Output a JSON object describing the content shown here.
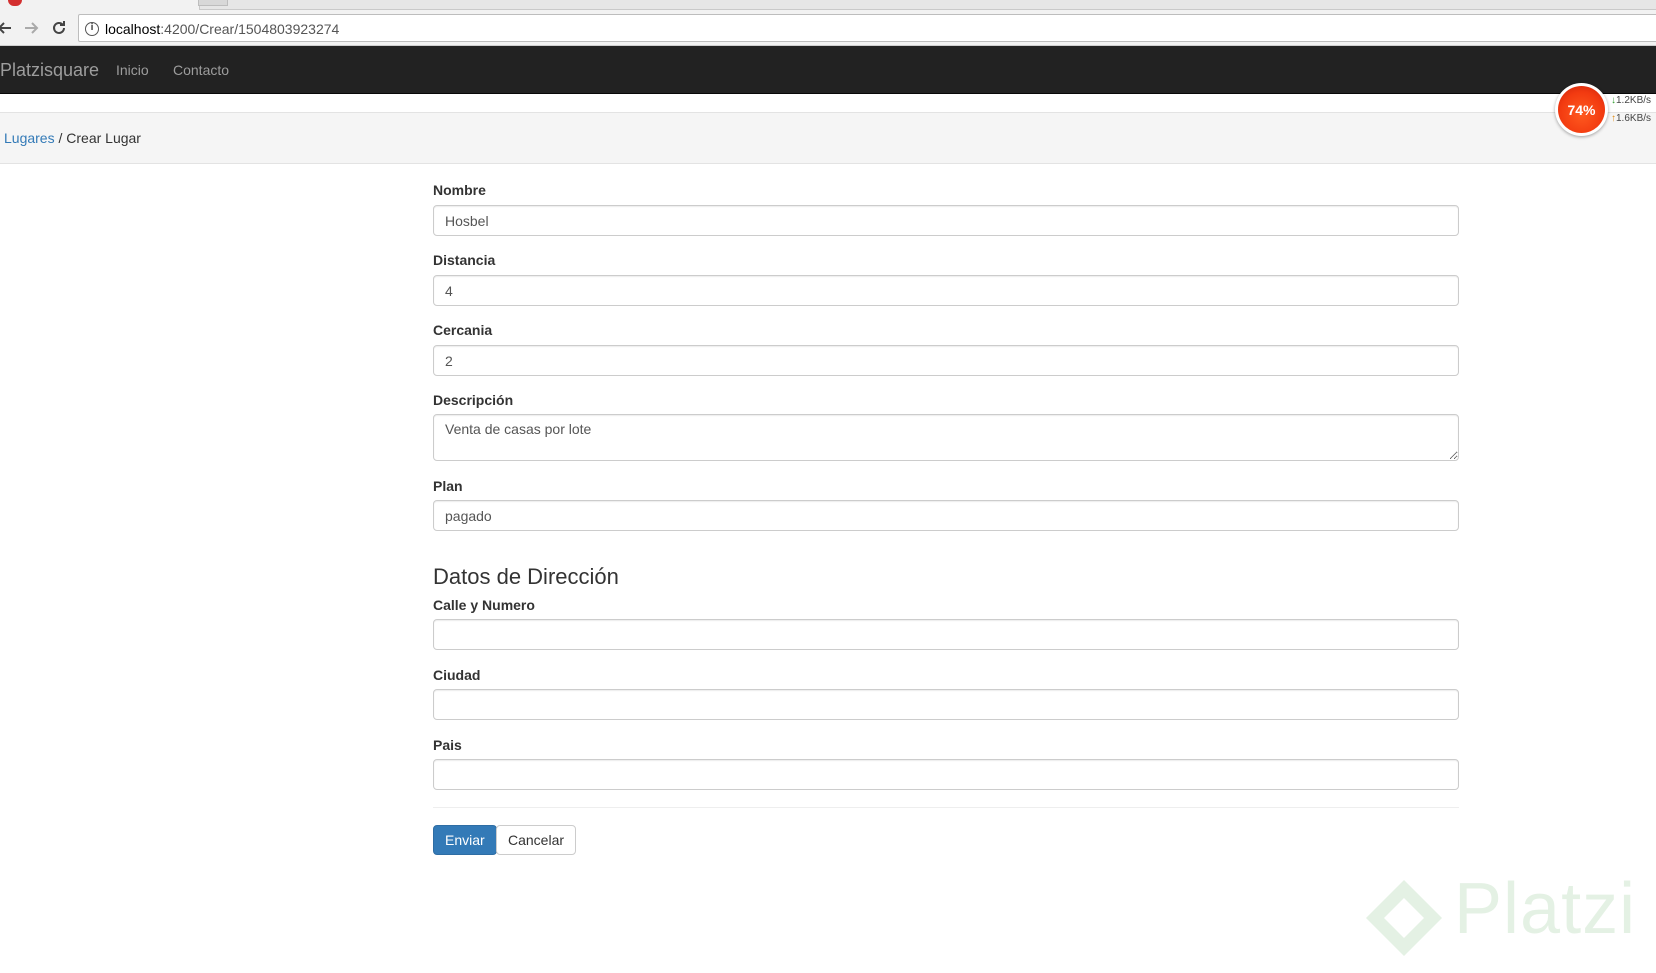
{
  "browser": {
    "url_host": "localhost",
    "url_path": ":4200/Crear/1504803923274"
  },
  "navbar": {
    "brand": "Platzisquare",
    "links": [
      "Inicio",
      "Contacto"
    ]
  },
  "breadcrumb": {
    "parent": "Lugares",
    "separator": "/",
    "current": "Crear Lugar"
  },
  "network_widget": {
    "percent": "74%",
    "download": "1.2KB/s",
    "upload": "1.6KB/s",
    "accent": "#f23a10"
  },
  "form": {
    "fields": [
      {
        "label": "Nombre",
        "value": "Hosbel"
      },
      {
        "label": "Distancia",
        "value": "4"
      },
      {
        "label": "Cercania",
        "value": "2"
      },
      {
        "label": "Descripción",
        "value": "Venta de casas por lote"
      },
      {
        "label": "Plan",
        "value": "pagado"
      }
    ],
    "address_section_title": "Datos de Dirección",
    "address_fields": [
      {
        "label": "Calle y Numero",
        "value": ""
      },
      {
        "label": "Ciudad",
        "value": ""
      },
      {
        "label": "Pais",
        "value": ""
      }
    ],
    "submit_label": "Enviar",
    "cancel_label": "Cancelar",
    "primary_color": "#337ab7"
  },
  "watermark": {
    "text": "Platzi",
    "color": "#3b9a3b"
  }
}
